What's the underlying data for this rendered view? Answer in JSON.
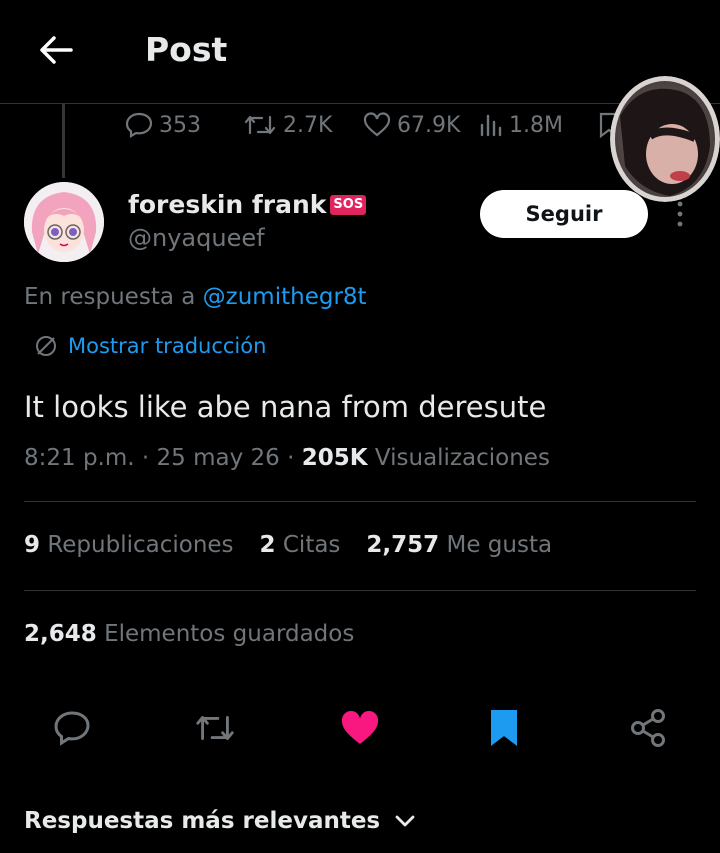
{
  "header": {
    "title": "Post"
  },
  "metrics": {
    "replies": "353",
    "reposts": "2.7K",
    "likes": "67.9K",
    "views": "1.8M"
  },
  "author": {
    "name": "foreskin frank",
    "badge": "SOS",
    "handle": "@nyaqueef"
  },
  "follow_label": "Seguir",
  "reply_context": {
    "prefix": "En respuesta a",
    "mention": "@zumithegr8t"
  },
  "translate_label": "Mostrar traducción",
  "tweet_text": "It looks like abe nana from deresute",
  "meta": {
    "time": "8:21 p.m.",
    "date": "25 may 26",
    "views": "205K",
    "views_label": "Visualizaciones",
    "sep": "·"
  },
  "stats": {
    "reposts": "9",
    "reposts_label": "Republicaciones",
    "quotes": "2",
    "quotes_label": "Citas",
    "likes": "2,757",
    "likes_label": "Me gusta"
  },
  "saved": {
    "count": "2,648",
    "label": "Elementos guardados"
  },
  "actions": [
    "reply-icon",
    "repost-icon",
    "like-icon",
    "bookmark-icon",
    "share-icon"
  ],
  "colors": {
    "accent": "#1d9bf0",
    "like": "#f91880",
    "bookmark": "#1d9bf0",
    "background": "#000000"
  },
  "sort_label": "Respuestas más relevantes"
}
